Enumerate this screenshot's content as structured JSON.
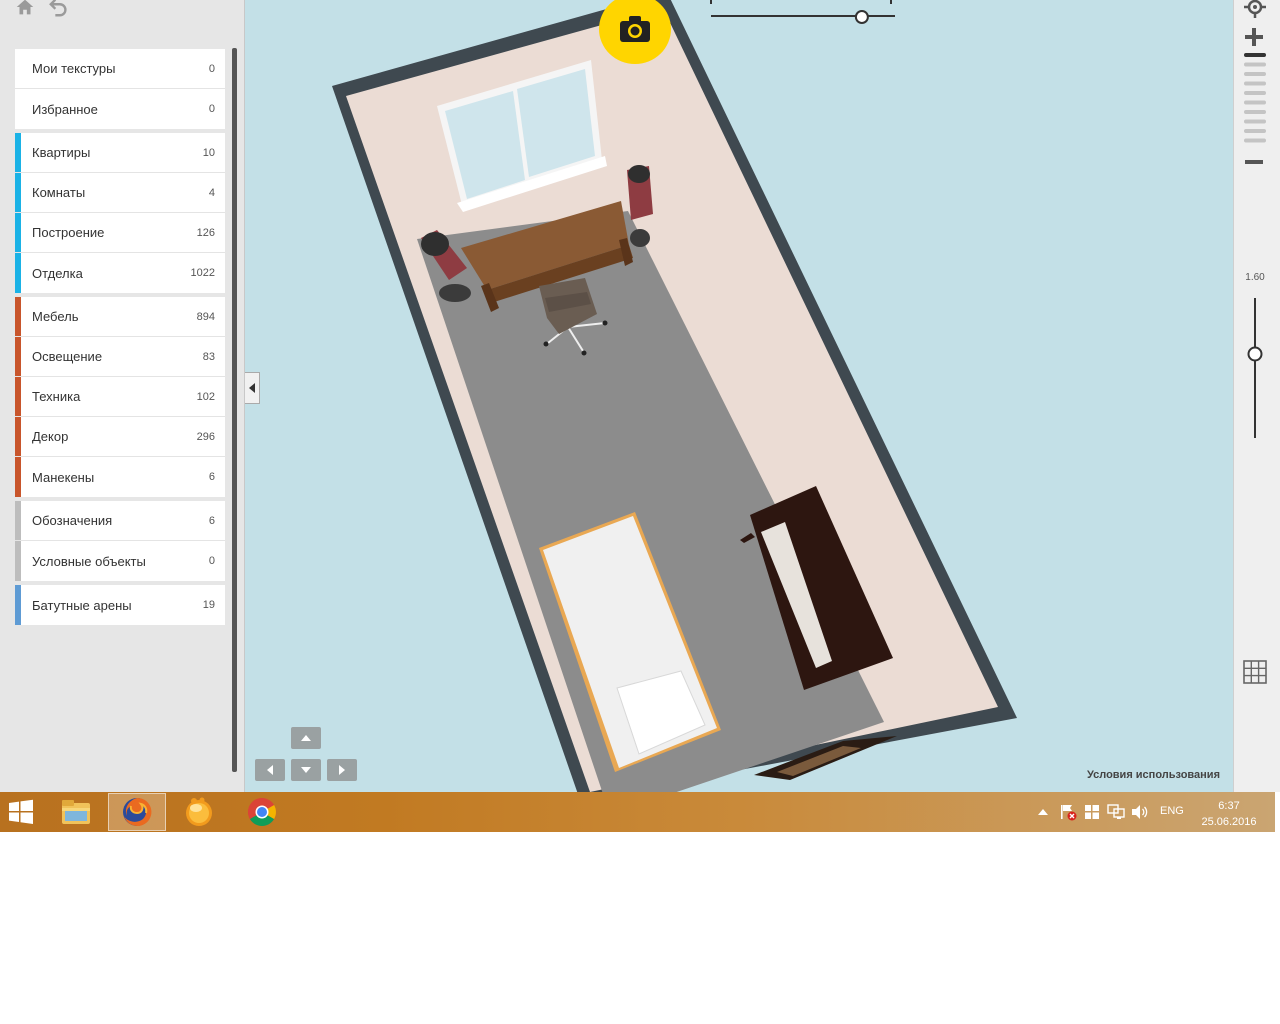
{
  "sidebar": {
    "groups": [
      {
        "color": "",
        "items": [
          {
            "label": "Мои текстуры",
            "count": "0"
          },
          {
            "label": "Избранное",
            "count": "0"
          }
        ]
      },
      {
        "color": "#1ab2e6",
        "items": [
          {
            "label": "Квартиры",
            "count": "10"
          },
          {
            "label": "Комнаты",
            "count": "4"
          },
          {
            "label": "Построение",
            "count": "126"
          },
          {
            "label": "Отделка",
            "count": "1022"
          }
        ]
      },
      {
        "color": "#c8552b",
        "items": [
          {
            "label": "Мебель",
            "count": "894"
          },
          {
            "label": "Освещение",
            "count": "83"
          },
          {
            "label": "Техника",
            "count": "102"
          },
          {
            "label": "Декор",
            "count": "296"
          },
          {
            "label": "Манекены",
            "count": "6"
          }
        ]
      },
      {
        "color": "#bdbdbd",
        "items": [
          {
            "label": "Обозначения",
            "count": "6"
          },
          {
            "label": "Условные объекты",
            "count": "0"
          }
        ]
      },
      {
        "color": "#5e9bd4",
        "items": [
          {
            "label": "Батутные арены",
            "count": "19"
          }
        ]
      }
    ]
  },
  "viewport": {
    "terms_label": "Условия использования",
    "zoom_value": "1.60",
    "zoom_slider_fraction": 0.6,
    "angle_slider_fraction": 0.82
  },
  "taskbar": {
    "apps": [
      "file-explorer-icon",
      "firefox-icon",
      "mail-icon",
      "chrome-icon"
    ],
    "active_app": "firefox-icon",
    "language": "ENG",
    "time": "6:37",
    "date": "25.06.2016"
  },
  "colors": {
    "viewport_bg": "#c3e0e7",
    "camera_button": "#ffd500",
    "furniture_stripe": "#c8552b",
    "rooms_stripe": "#1ab2e6"
  }
}
